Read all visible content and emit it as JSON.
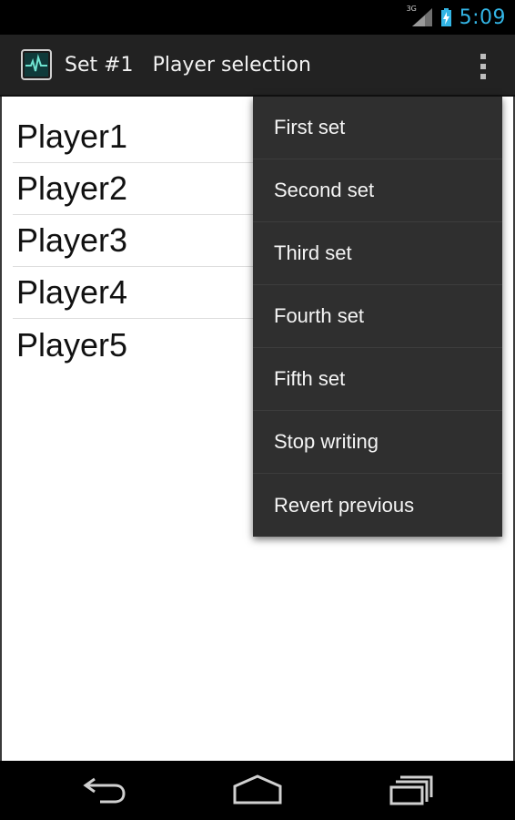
{
  "status_bar": {
    "network_tag": "3G",
    "time": "5:09",
    "accent_color": "#33b5e5"
  },
  "action_bar": {
    "app_icon": "pulse-monitor-icon",
    "title": "Set #1",
    "subtitle": "Player selection",
    "overflow_icon": "overflow-vertical-dots-icon"
  },
  "players": [
    "Player1",
    "Player2",
    "Player3",
    "Player4",
    "Player5"
  ],
  "overflow_menu": {
    "items": [
      "First set",
      "Second set",
      "Third set",
      "Fourth set",
      "Fifth set",
      "Stop writing",
      "Revert previous"
    ]
  },
  "nav_bar": {
    "buttons": [
      "back-icon",
      "home-icon",
      "recent-apps-icon"
    ]
  }
}
